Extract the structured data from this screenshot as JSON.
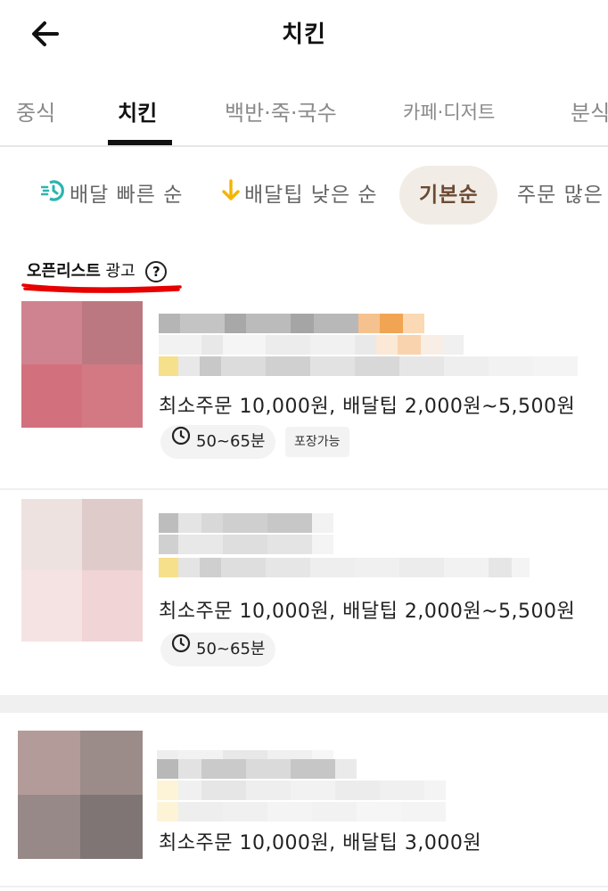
{
  "header": {
    "title": "치킨",
    "back_icon": "arrow-left-icon"
  },
  "categories": [
    {
      "label": "중식"
    },
    {
      "label": "치킨",
      "active": true
    },
    {
      "label": "백반·죽·국수"
    },
    {
      "label": "카페·디저트"
    },
    {
      "label": "분식"
    }
  ],
  "sort": [
    {
      "label": "배달 빠른 순",
      "icon": "fast-delivery-icon",
      "icon_color": "#2bb5b0"
    },
    {
      "label": "배달팁 낮은 순",
      "icon": "arrow-down-icon",
      "icon_color": "#f5b400"
    },
    {
      "label": "기본순",
      "active": true
    },
    {
      "label": "주문 많은 순"
    }
  ],
  "ad_section": {
    "title_strong": "오픈리스트",
    "title_rest": "광고",
    "help_icon": "question-circle-icon",
    "help_glyph": "?"
  },
  "restaurants": [
    {
      "min_order": "최소주문 10,000원, 배달팁 2,000원~5,500원",
      "delivery_time": "50~65분",
      "badge": "포장가능"
    },
    {
      "min_order": "최소주문 10,000원, 배달팁 2,000원~5,500원",
      "delivery_time": "50~65분"
    },
    {
      "min_order": "최소주문 10,000원, 배달팁 3,000원"
    }
  ],
  "colors": {
    "accent_chip_bg": "#f1ece5",
    "accent_chip_text": "#6b4a33",
    "scribble": "#e60000"
  }
}
